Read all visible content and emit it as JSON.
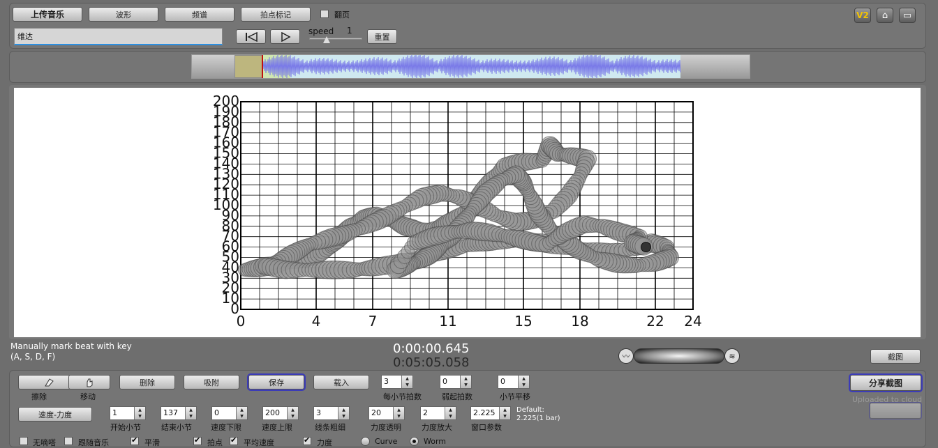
{
  "top": {
    "upload": "上传音乐",
    "waveform": "波形",
    "spectrum": "频谱",
    "beat_mark": "拍点标记",
    "page_flip": "翻页",
    "song_title": "维达",
    "speed_label": "speed",
    "speed_value": "1",
    "reset": "重置",
    "v2": "V2"
  },
  "chart_data": {
    "type": "scatter",
    "xlim": [
      0,
      24
    ],
    "ylim": [
      0,
      200
    ],
    "x_ticks": [
      "0",
      "4",
      "7",
      "11",
      "15",
      "18",
      "22",
      "24"
    ],
    "y_ticks": [
      "0",
      "10",
      "20",
      "30",
      "40",
      "50",
      "60",
      "70",
      "80",
      "90",
      "100",
      "110",
      "120",
      "130",
      "140",
      "150",
      "160",
      "170",
      "180",
      "190",
      "200"
    ],
    "grid": true,
    "marker": "worm",
    "points": [
      [
        0.2,
        38
      ],
      [
        1,
        40
      ],
      [
        2,
        43
      ],
      [
        3,
        47
      ],
      [
        4,
        52
      ],
      [
        4.8,
        60
      ],
      [
        5.3,
        70
      ],
      [
        5.8,
        80
      ],
      [
        6.5,
        88
      ],
      [
        7.2,
        90
      ],
      [
        8,
        86
      ],
      [
        8.7,
        80
      ],
      [
        9.5,
        76
      ],
      [
        10.5,
        78
      ],
      [
        11.2,
        85
      ],
      [
        12,
        95
      ],
      [
        12.7,
        110
      ],
      [
        13.3,
        125
      ],
      [
        14,
        138
      ],
      [
        15,
        142
      ],
      [
        16,
        143
      ],
      [
        16.4,
        158
      ],
      [
        16.8,
        150
      ],
      [
        17.5,
        148
      ],
      [
        18.4,
        145
      ],
      [
        18,
        128
      ],
      [
        17.4,
        110
      ],
      [
        16.6,
        95
      ],
      [
        15.6,
        86
      ],
      [
        14.6,
        84
      ],
      [
        13.6,
        90
      ],
      [
        12.6,
        100
      ],
      [
        11.6,
        108
      ],
      [
        10.6,
        112
      ],
      [
        9.6,
        108
      ],
      [
        8.6,
        98
      ],
      [
        7.6,
        88
      ],
      [
        6.6,
        80
      ],
      [
        5.6,
        73
      ],
      [
        4.6,
        68
      ],
      [
        3.6,
        62
      ],
      [
        2.8,
        54
      ],
      [
        2,
        46
      ],
      [
        1.2,
        42
      ],
      [
        2.4,
        38
      ],
      [
        3.6,
        38
      ],
      [
        4.8,
        38
      ],
      [
        6,
        38
      ],
      [
        7,
        40
      ],
      [
        8.2,
        44
      ],
      [
        9.4,
        50
      ],
      [
        10.6,
        56
      ],
      [
        11.6,
        60
      ],
      [
        12.6,
        64
      ],
      [
        13.6,
        66
      ],
      [
        14.8,
        66
      ],
      [
        16,
        64
      ],
      [
        17.2,
        60
      ],
      [
        18.4,
        56
      ],
      [
        19.6,
        55
      ],
      [
        20.8,
        58
      ],
      [
        21.8,
        64
      ],
      [
        22.6,
        60
      ],
      [
        22.8,
        50
      ],
      [
        22,
        45
      ],
      [
        21,
        42
      ],
      [
        20,
        44
      ],
      [
        19,
        48
      ],
      [
        18,
        56
      ],
      [
        17.2,
        66
      ],
      [
        16.4,
        78
      ],
      [
        15.8,
        92
      ],
      [
        15.4,
        108
      ],
      [
        15,
        122
      ],
      [
        14.6,
        130
      ],
      [
        13.8,
        124
      ],
      [
        13,
        112
      ],
      [
        12.4,
        98
      ],
      [
        11.8,
        84
      ],
      [
        11.2,
        70
      ],
      [
        10.6,
        60
      ],
      [
        10,
        52
      ],
      [
        9.4,
        46
      ],
      [
        8.8,
        42
      ],
      [
        8.2,
        38
      ],
      [
        9.2,
        64
      ],
      [
        10.2,
        70
      ],
      [
        11.2,
        74
      ],
      [
        12.2,
        76
      ],
      [
        13.2,
        74
      ],
      [
        14.2,
        70
      ],
      [
        15.2,
        66
      ],
      [
        16.2,
        62
      ],
      [
        17.2,
        74
      ],
      [
        18.2,
        82
      ],
      [
        19.2,
        80
      ],
      [
        20.2,
        74
      ],
      [
        21.2,
        70
      ],
      [
        20.8,
        64
      ],
      [
        21.5,
        60
      ]
    ]
  },
  "status": {
    "hint1": "Manually mark beat with key",
    "hint2": "(A, S, D, F)",
    "time_current": "0:00:00.645",
    "time_total": "0:05:05.058",
    "screenshot": "截图"
  },
  "bottom": {
    "erase": "擦除",
    "move": "移动",
    "delete": "删除",
    "absorb": "吸附",
    "save": "保存",
    "load": "载入",
    "beats_per_bar_val": "3",
    "beats_per_bar": "每小节拍数",
    "pickup_val": "0",
    "pickup": "弱起拍数",
    "bar_offset_val": "0",
    "bar_offset": "小节平移",
    "share": "分享截图",
    "uploaded": "Uploaded to cloud",
    "tempo_force": "速度-力度",
    "start_bar_val": "1",
    "start_bar": "开始小节",
    "end_bar_val": "137",
    "end_bar": "结束小节",
    "tempo_min_val": "0",
    "tempo_min": "速度下限",
    "tempo_max_val": "200",
    "tempo_max": "速度上限",
    "line_width_val": "3",
    "line_width": "线条粗细",
    "force_alpha_val": "20",
    "force_alpha": "力度透明",
    "force_zoom_val": "2",
    "force_zoom": "力度放大",
    "window_val": "2.225",
    "window": "窗口参数",
    "default1": "Default:",
    "default2": "2.225(1 bar)",
    "no_metronome": "无嘀嗒",
    "follow_music": "跟随音乐",
    "smooth": "平滑",
    "beat_point": "拍点",
    "avg_tempo": "平均速度",
    "force": "力度",
    "curve": "Curve",
    "worm": "Worm"
  }
}
